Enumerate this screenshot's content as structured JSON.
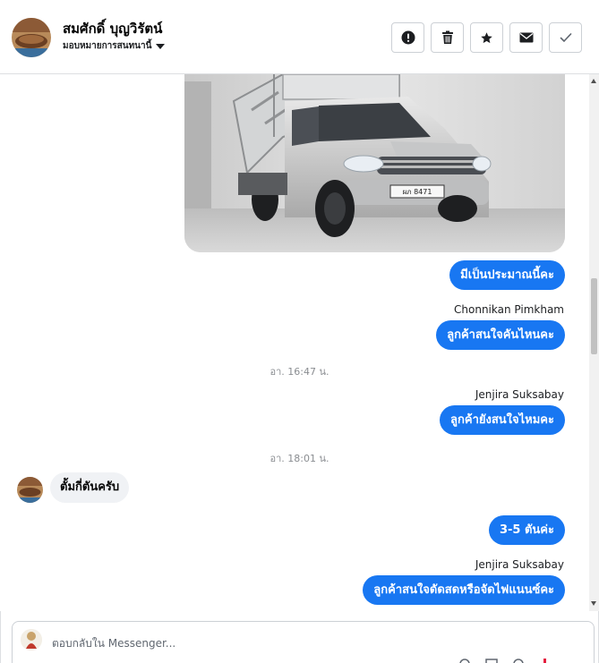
{
  "header": {
    "contact_name": "สมศักดิ์ บุญวิรัตน์",
    "assign_label": "มอบหมายการสนทนานี้",
    "actions": [
      {
        "name": "report-button",
        "icon": "exclamation-circle-icon"
      },
      {
        "name": "delete-button",
        "icon": "trash-icon"
      },
      {
        "name": "star-button",
        "icon": "star-icon"
      },
      {
        "name": "mark-unread-button",
        "icon": "envelope-icon"
      },
      {
        "name": "done-button",
        "icon": "check-icon"
      }
    ]
  },
  "messages": {
    "m1": {
      "text": "มีเป็นประมาณนี้คะ"
    },
    "sender2": "Chonnikan Pimkham",
    "m2": {
      "text": "ลูกค้าสนใจคันไหนคะ"
    },
    "time1": "อา. 16:47 น.",
    "sender3": "Jenjira Suksabay",
    "m3": {
      "text": "ลูกค้ายังสนใจไหมคะ"
    },
    "time2": "อา. 18:01 น.",
    "m4": {
      "text": "ตั้มกี่ตันครับ"
    },
    "m5": {
      "text": "3-5 ตันค่ะ"
    },
    "sender5": "Jenjira Suksabay",
    "m6": {
      "text": "ลูกค้าสนใจดัดสดหรือจัดไฟแนนซ์คะ"
    }
  },
  "vehicle_photo": {
    "plate": "ผภ 8471"
  },
  "composer": {
    "placeholder": "ตอบกลับใน Messenger..."
  },
  "colors": {
    "accent": "#1877f2",
    "incoming_bubble": "#f0f2f5"
  }
}
